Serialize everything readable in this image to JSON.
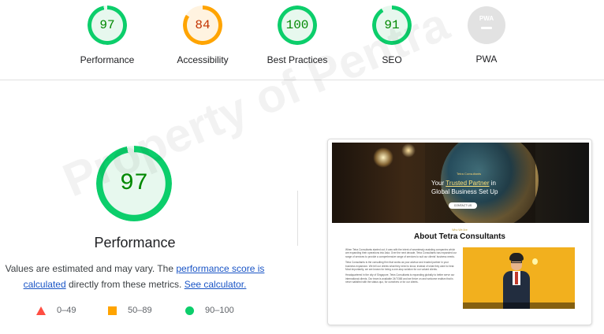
{
  "categories": [
    {
      "label": "Performance",
      "score": "97",
      "color": "#0cce6b",
      "text_color": "#008800",
      "fill_fraction": 0.97
    },
    {
      "label": "Accessibility",
      "score": "84",
      "color": "#ffa400",
      "text_color": "#c33300",
      "fill_fraction": 0.84
    },
    {
      "label": "Best Practices",
      "score": "100",
      "color": "#0cce6b",
      "text_color": "#008800",
      "fill_fraction": 1.0
    },
    {
      "label": "SEO",
      "score": "91",
      "color": "#0cce6b",
      "text_color": "#008800",
      "fill_fraction": 0.91
    },
    {
      "label": "PWA",
      "badge_text": "PWA"
    }
  ],
  "main": {
    "score": "97",
    "fill_fraction": 0.97,
    "title": "Performance",
    "desc_before": "Values are estimated and may vary. The ",
    "link_score": "performance score is calculated",
    "desc_middle": " directly from these metrics. ",
    "link_calc": "See calculator."
  },
  "legend": [
    {
      "range": "0–49",
      "color": "#ff4e42",
      "shape": "triangle"
    },
    {
      "range": "50–89",
      "color": "#ffa400",
      "shape": "square"
    },
    {
      "range": "90–100",
      "color": "#0cce6b",
      "shape": "circle"
    }
  ],
  "preview": {
    "hero_small": "Tetra Consultants",
    "hero_line1_before": "Your ",
    "hero_line1_highlight": "Trusted Partner",
    "hero_line1_after": " in",
    "hero_line2": "Global Business Set Up",
    "hero_button": "CONTACT US",
    "section_small": "Who We Are",
    "heading": "About Tetra Consultants",
    "paragraphs": [
      "When Tetra Consultants started out, it was with the intent of seamlessly assisting companies which are expanding their operations into Asia. Over the next decade, Tetra Consultants has expanded our range of services to provide a comprehensive range of services to suit our clients' business needs.",
      "Tetra Consultants is the consulting firm that works as your advisor and trusted partner in your business expansion. We tell our clients what they need to know, instead of what they want to hear. Most importantly, we are known for being a one-stop solution for our valued clients.",
      "Headquartered in the city of Singapore, Tetra Consultants is expanding globally to better serve our international clients. Our team is available 24/7/365 and we thrive on and welcome realism that is never satisfied with the status quo, for ourselves or for our clients."
    ]
  },
  "watermark": "Property of Pentra"
}
